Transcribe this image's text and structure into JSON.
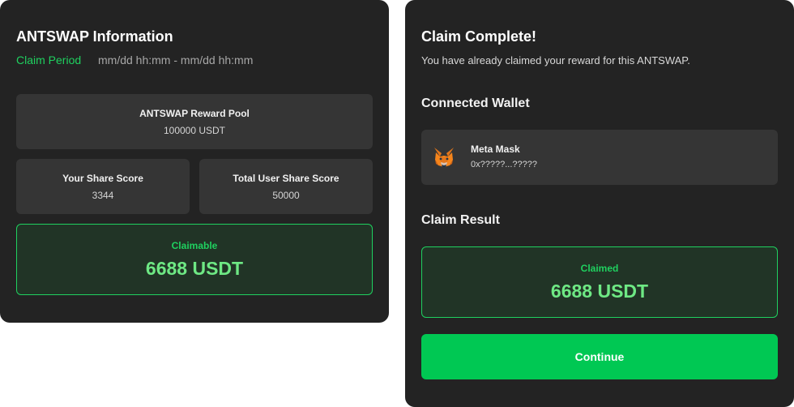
{
  "info": {
    "title": "ANTSWAP Information",
    "claim_period_label": "Claim Period",
    "claim_period_value": "mm/dd hh:mm - mm/dd hh:mm",
    "reward_pool": {
      "label": "ANTSWAP Reward Pool",
      "value": "100000 USDT"
    },
    "your_share": {
      "label": "Your Share Score",
      "value": "3344"
    },
    "total_share": {
      "label": "Total User Share Score",
      "value": "50000"
    },
    "claimable": {
      "label": "Claimable",
      "value": "6688 USDT"
    }
  },
  "complete": {
    "title": "Claim Complete!",
    "description": "You have already claimed your reward for this ANTSWAP.",
    "wallet_heading": "Connected Wallet",
    "wallet": {
      "name": "Meta Mask",
      "address": "0x?????...?????",
      "icon": "metamask-fox-icon"
    },
    "result_heading": "Claim Result",
    "claimed": {
      "label": "Claimed",
      "value": "6688 USDT"
    },
    "continue_label": "Continue"
  },
  "colors": {
    "panel_bg": "#232323",
    "card_bg": "#353535",
    "accent_green": "#1fd05f",
    "amount_green": "#6ee884",
    "button_green": "#00c853"
  }
}
